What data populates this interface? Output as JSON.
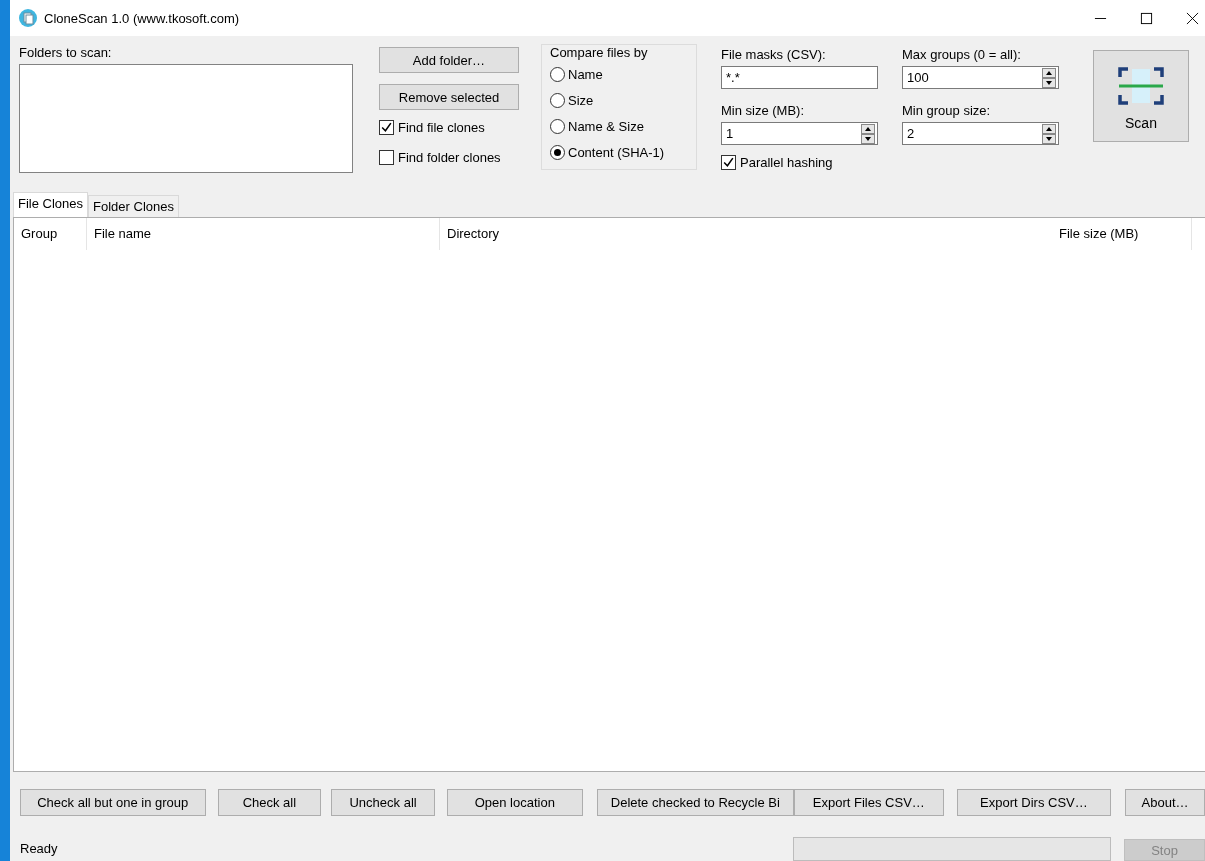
{
  "window": {
    "title": "CloneScan 1.0 (www.tkosoft.com)"
  },
  "folders": {
    "label": "Folders to scan:"
  },
  "folder_buttons": [
    "Add folder…",
    "Remove selected"
  ],
  "find_options": [
    {
      "label": "Find file clones",
      "checked": true
    },
    {
      "label": "Find folder clones",
      "checked": false
    }
  ],
  "compare": {
    "title": "Compare files by",
    "options": [
      {
        "label": "Name",
        "selected": false
      },
      {
        "label": "Size",
        "selected": false
      },
      {
        "label": "Name & Size",
        "selected": false
      },
      {
        "label": "Content (SHA-1)",
        "selected": true
      }
    ]
  },
  "fields": [
    {
      "label": "File masks (CSV):",
      "value": "*.*",
      "kind": "text"
    },
    {
      "label": "Max groups (0 = all):",
      "value": "100",
      "kind": "spin"
    },
    {
      "label": "Min size (MB):",
      "value": "1",
      "kind": "spin"
    },
    {
      "label": "Min group size:",
      "value": "2",
      "kind": "spin"
    }
  ],
  "parallel_hashing": {
    "label": "Parallel hashing",
    "checked": true
  },
  "scan_button": {
    "label": "Scan"
  },
  "tabs": [
    {
      "label": "File Clones",
      "selected": true
    },
    {
      "label": "Folder Clones",
      "selected": false
    }
  ],
  "table": {
    "columns": [
      "Group",
      "File name",
      "Directory",
      "File size (MB)"
    ]
  },
  "bottom_buttons": [
    {
      "label": "Check all but one in group",
      "disabled": false
    },
    {
      "label": "Check all",
      "disabled": false
    },
    {
      "label": "Uncheck all",
      "disabled": false
    },
    {
      "label": "Open location",
      "disabled": false
    },
    {
      "label": "Delete checked to Recycle Bi",
      "disabled": false
    },
    {
      "label": "Export Files CSV…",
      "disabled": false
    },
    {
      "label": "Export Dirs CSV…",
      "disabled": false
    },
    {
      "label": "About…",
      "disabled": false
    }
  ],
  "status_bar": {
    "text": "Ready",
    "progress": {
      "level": 0
    },
    "stop_button": {
      "label": "Stop",
      "disabled": true
    }
  }
}
